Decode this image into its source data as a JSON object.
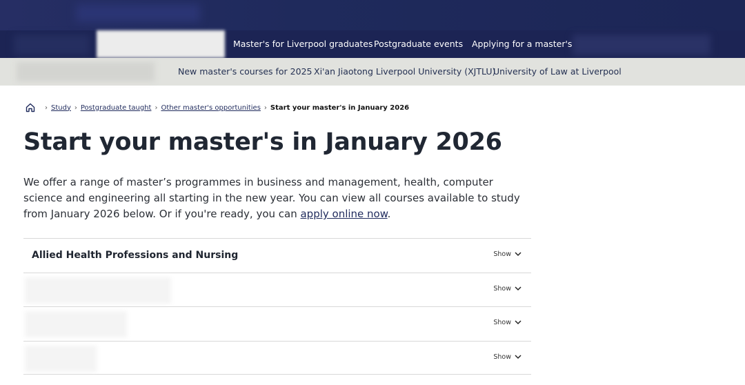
{
  "nav_primary": {
    "items": [
      {
        "label": "Master's for Liverpool graduates"
      },
      {
        "label": "Postgraduate events"
      },
      {
        "label": "Applying for a master's"
      }
    ]
  },
  "nav_secondary": {
    "items": [
      {
        "label": "New master's courses for 2025"
      },
      {
        "label": "Xi'an Jiaotong Liverpool University (XJTLU)"
      },
      {
        "label": "University of Law at Liverpool"
      }
    ]
  },
  "breadcrumb": {
    "home_icon": "home-icon",
    "items": [
      {
        "label": "Study"
      },
      {
        "label": "Postgraduate taught"
      },
      {
        "label": "Other master's opportunities"
      }
    ],
    "current": "Start your master's in January 2026"
  },
  "page": {
    "title": "Start your master's in January 2026",
    "intro_text": "We offer a range of master’s programmes in business and management, health, computer science and engineering all starting in the new year. You can view all courses available to study from January 2026 below. Or if you're ready, you can ",
    "intro_link": "apply online now",
    "intro_end": "."
  },
  "accordion": {
    "items": [
      {
        "title": "Allied Health Professions and Nursing",
        "toggle": "Show"
      },
      {
        "title": "",
        "toggle": "Show"
      },
      {
        "title": "",
        "toggle": "Show"
      },
      {
        "title": "",
        "toggle": "Show"
      }
    ]
  }
}
